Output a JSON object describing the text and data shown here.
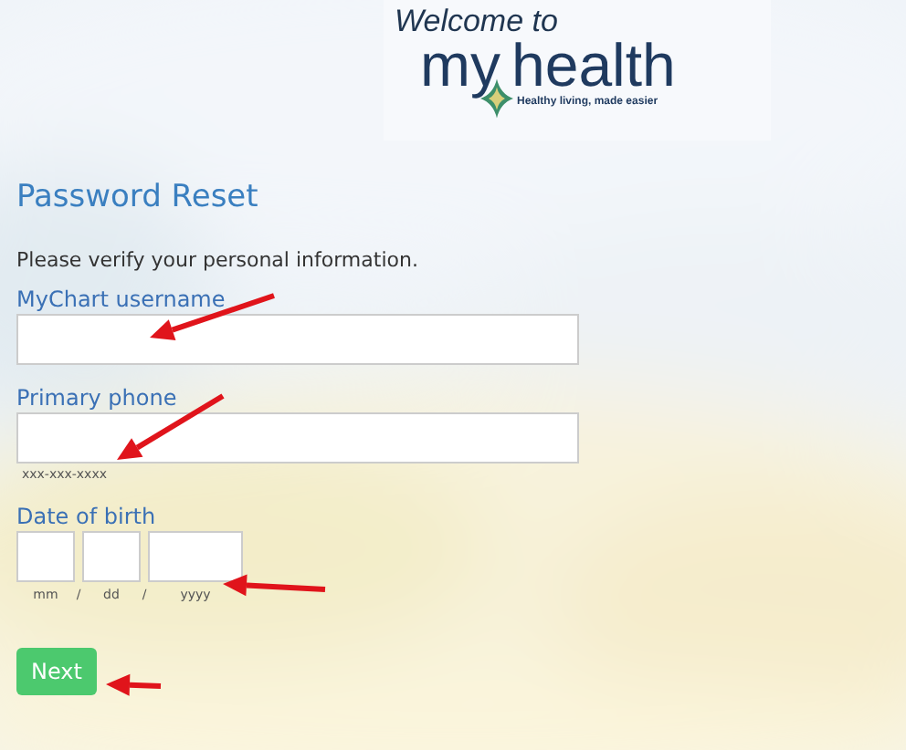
{
  "logo": {
    "welcome": "Welcome to",
    "brand_first": "my",
    "brand_second": "health",
    "tagline": "Healthy living, made easier"
  },
  "title": "Password Reset",
  "instruction": "Please verify your personal information.",
  "fields": [
    {
      "label": "MyChart username"
    },
    {
      "label": "Primary phone",
      "hint": "xxx-xxx-xxxx"
    }
  ],
  "date_of_birth": {
    "label": "Date of birth",
    "parts": [
      {
        "hint": "mm"
      },
      {
        "hint": "dd"
      },
      {
        "hint": "yyyy"
      }
    ],
    "separators": [
      "/",
      "/"
    ]
  },
  "buttons": [
    {
      "label": "Next"
    }
  ]
}
